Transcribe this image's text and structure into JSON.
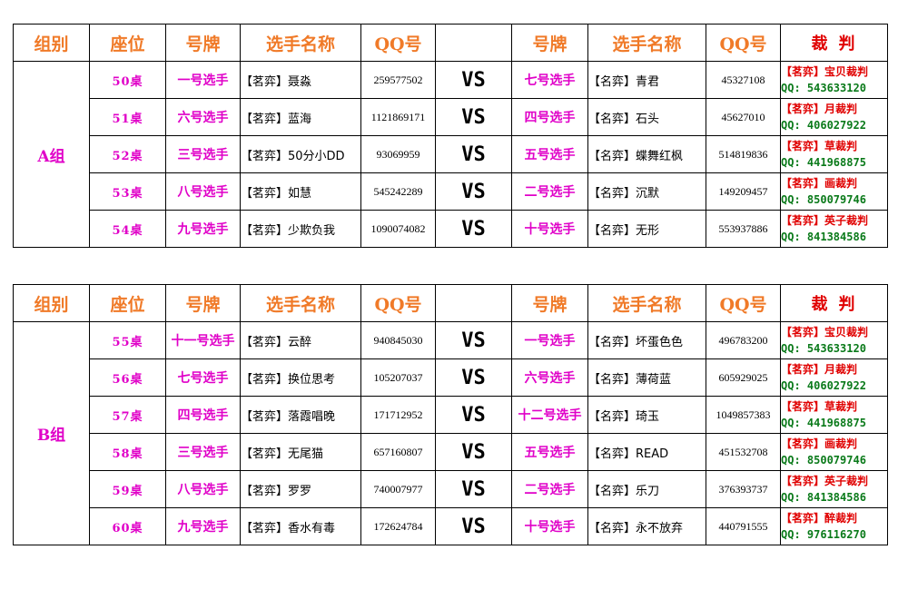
{
  "headers": {
    "group": "组别",
    "seat": "座位",
    "number": "号牌",
    "name": "选手名称",
    "qq": "QQ号",
    "vs_header": "",
    "number2": "号牌",
    "name2": "选手名称",
    "qq2": "QQ号",
    "referee": "裁判"
  },
  "vs": "VS",
  "group_a": {
    "label": "A组",
    "rows": [
      {
        "seat": "50桌",
        "left_num": "一号选手",
        "left_name": "【茗弈】聂淼",
        "left_qq": "259577502",
        "right_num": "七号选手",
        "right_name": "【名弈】青君",
        "right_qq": "45327108",
        "ref_name": "【茗弈】宝贝裁判",
        "ref_qq": "QQ: 543633120"
      },
      {
        "seat": "51桌",
        "left_num": "六号选手",
        "left_name": "【茗弈】蓝海",
        "left_qq": "1121869171",
        "right_num": "四号选手",
        "right_name": "【名弈】石头",
        "right_qq": "45627010",
        "ref_name": "【茗弈】月裁判",
        "ref_qq": "QQ: 406027922"
      },
      {
        "seat": "52桌",
        "left_num": "三号选手",
        "left_name": "【茗弈】50分小DD",
        "left_qq": "93069959",
        "right_num": "五号选手",
        "right_name": "【名弈】蝶舞红枫",
        "right_qq": "514819836",
        "ref_name": "【茗弈】草裁判",
        "ref_qq": "QQ: 441968875"
      },
      {
        "seat": "53桌",
        "left_num": "八号选手",
        "left_name": "【茗弈】如慧",
        "left_qq": "545242289",
        "right_num": "二号选手",
        "right_name": "【名弈】沉默",
        "right_qq": "149209457",
        "ref_name": "【茗弈】画裁判",
        "ref_qq": "QQ: 850079746"
      },
      {
        "seat": "54桌",
        "left_num": "九号选手",
        "left_name": "【茗弈】少欺负我",
        "left_qq": "1090074082",
        "right_num": "十号选手",
        "right_name": "【名弈】无形",
        "right_qq": "553937886",
        "ref_name": "【茗弈】英子裁判",
        "ref_qq": "QQ: 841384586"
      }
    ]
  },
  "group_b": {
    "label": "B组",
    "rows": [
      {
        "seat": "55桌",
        "left_num": "十一号选手",
        "left_name": "【茗弈】云醉",
        "left_qq": "940845030",
        "right_num": "一号选手",
        "right_name": "【名弈】坏蛋色色",
        "right_qq": "496783200",
        "ref_name": "【茗弈】宝贝裁判",
        "ref_qq": "QQ: 543633120"
      },
      {
        "seat": "56桌",
        "left_num": "七号选手",
        "left_name": "【茗弈】换位思考",
        "left_qq": "105207037",
        "right_num": "六号选手",
        "right_name": "【名弈】薄荷蓝",
        "right_qq": "605929025",
        "ref_name": "【茗弈】月裁判",
        "ref_qq": "QQ: 406027922"
      },
      {
        "seat": "57桌",
        "left_num": "四号选手",
        "left_name": "【茗弈】落霞唱晚",
        "left_qq": "171712952",
        "right_num": "十二号选手",
        "right_name": "【名弈】琦玉",
        "right_qq": "1049857383",
        "ref_name": "【茗弈】草裁判",
        "ref_qq": "QQ: 441968875"
      },
      {
        "seat": "58桌",
        "left_num": "三号选手",
        "left_name": "【茗弈】无尾猫",
        "left_qq": "657160807",
        "right_num": "五号选手",
        "right_name": "【名弈】READ",
        "right_qq": "451532708",
        "ref_name": "【茗弈】画裁判",
        "ref_qq": "QQ: 850079746"
      },
      {
        "seat": "59桌",
        "left_num": "八号选手",
        "left_name": "【茗弈】罗罗",
        "left_qq": "740007977",
        "right_num": "二号选手",
        "right_name": "【名弈】乐刀",
        "right_qq": "376393737",
        "ref_name": "【茗弈】英子裁判",
        "ref_qq": "QQ: 841384586"
      },
      {
        "seat": "60桌",
        "left_num": "九号选手",
        "left_name": "【茗弈】香水有毒",
        "left_qq": "172624784",
        "right_num": "十号选手",
        "right_name": "【名弈】永不放弃",
        "right_qq": "440791555",
        "ref_name": "【茗弈】醉裁判",
        "ref_qq": "QQ: 976116270"
      }
    ]
  }
}
